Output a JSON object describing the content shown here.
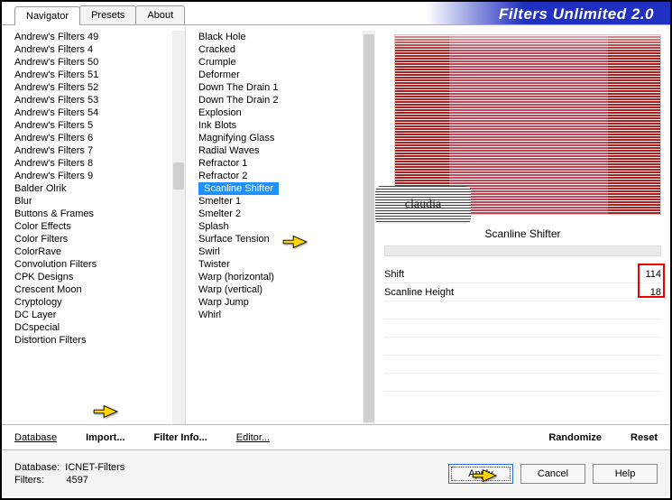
{
  "brand": "Filters Unlimited 2.0",
  "tabs": [
    "Navigator",
    "Presets",
    "About"
  ],
  "active_tab": 0,
  "categories": [
    "Andrew's Filters 49",
    "Andrew's Filters 4",
    "Andrew's Filters 50",
    "Andrew's Filters 51",
    "Andrew's Filters 52",
    "Andrew's Filters 53",
    "Andrew's Filters 54",
    "Andrew's Filters 5",
    "Andrew's Filters 6",
    "Andrew's Filters 7",
    "Andrew's Filters 8",
    "Andrew's Filters 9",
    "Balder Olrik",
    "Blur",
    "Buttons & Frames",
    "Color Effects",
    "Color Filters",
    "ColorRave",
    "Convolution Filters",
    "CPK Designs",
    "Crescent Moon",
    "Cryptology",
    "DC Layer",
    "DCspecial",
    "Distortion Filters"
  ],
  "filters": [
    "Black Hole",
    "Cracked",
    "Crumple",
    "Deformer",
    "Down The Drain 1",
    "Down The Drain 2",
    "Explosion",
    "Ink Blots",
    "Magnifying Glass",
    "Radial Waves",
    "Refractor 1",
    "Refractor 2",
    "Scanline Shifter",
    "Smelter 1",
    "Smelter 2",
    "Splash",
    "Surface Tension",
    "Swirl",
    "Twister",
    "Warp (horizontal)",
    "Warp (vertical)",
    "Warp Jump",
    "Whirl"
  ],
  "selected_filter_index": 12,
  "filter_title": "Scanline Shifter",
  "params": [
    {
      "label": "Shift",
      "value": "114"
    },
    {
      "label": "Scanline Height",
      "value": "18"
    }
  ],
  "linkbar": {
    "database": "Database",
    "import": "Import...",
    "filterinfo": "Filter Info...",
    "editor": "Editor...",
    "randomize": "Randomize",
    "reset": "Reset"
  },
  "footer": {
    "db_label": "Database:",
    "db_value": "ICNET-Filters",
    "filters_label": "Filters:",
    "filters_value": "4597",
    "apply": "Apply",
    "cancel": "Cancel",
    "help": "Help"
  },
  "watermark": "claudia"
}
